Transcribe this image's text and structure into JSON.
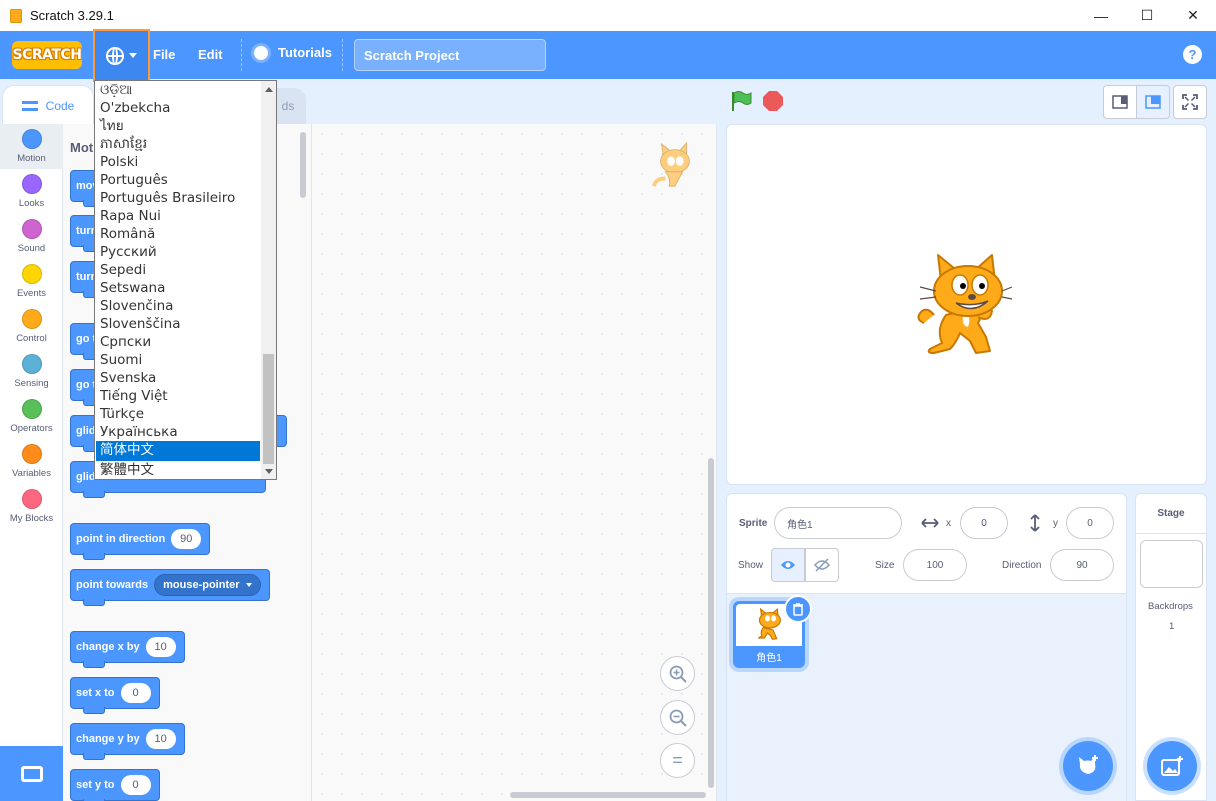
{
  "window": {
    "title": "Scratch 3.29.1",
    "minimize": "—",
    "maximize": "☐",
    "close": "✕"
  },
  "menubar": {
    "logo": "SCRATCH",
    "file": "File",
    "edit": "Edit",
    "tutorials": "Tutorials",
    "project_title": "Scratch Project",
    "help": "?"
  },
  "tabs": {
    "code": "Code",
    "sounds_partial": "ds"
  },
  "categories": [
    {
      "label": "Motion",
      "color": "#4c97ff"
    },
    {
      "label": "Looks",
      "color": "#9966ff"
    },
    {
      "label": "Sound",
      "color": "#cf63cf"
    },
    {
      "label": "Events",
      "color": "#ffd500"
    },
    {
      "label": "Control",
      "color": "#ffab19"
    },
    {
      "label": "Sensing",
      "color": "#5cb1d6"
    },
    {
      "label": "Operators",
      "color": "#59c059"
    },
    {
      "label": "Variables",
      "color": "#ff8c1a"
    },
    {
      "label": "My Blocks",
      "color": "#ff6680"
    }
  ],
  "palette": {
    "title_partial": "Moti",
    "partial_blocks": [
      "mov",
      "turn",
      "turn",
      "go t",
      "go t",
      "glide",
      "glide"
    ],
    "point_in_direction": {
      "label": "point in direction",
      "value": "90"
    },
    "point_towards": {
      "label": "point towards",
      "value": "mouse-pointer"
    },
    "change_x": {
      "label": "change x by",
      "value": "10"
    },
    "set_x": {
      "label": "set x to",
      "value": "0"
    },
    "change_y": {
      "label": "change y by",
      "value": "10"
    },
    "set_y": {
      "label": "set y to",
      "value": "0"
    }
  },
  "zoom": {
    "zoom_in": "+",
    "zoom_out": "−",
    "reset": "="
  },
  "sprite_info": {
    "sprite_label": "Sprite",
    "sprite_name": "角色1",
    "x_label": "x",
    "x_value": "0",
    "y_label": "y",
    "y_value": "0",
    "show_label": "Show",
    "size_label": "Size",
    "size_value": "100",
    "direction_label": "Direction",
    "direction_value": "90"
  },
  "sprite_list": [
    {
      "name": "角色1"
    }
  ],
  "stage_pane": {
    "title": "Stage",
    "backdrops_label": "Backdrops",
    "backdrops_count": "1"
  },
  "language_menu": {
    "options": [
      "ଓଡ଼ିଆ",
      "O'zbekcha",
      "ไทย",
      "ភាសាខ្មែរ",
      "Polski",
      "Português",
      "Português Brasileiro",
      "Rapa Nui",
      "Română",
      "Русский",
      "Sepedi",
      "Setswana",
      "Slovenčina",
      "Slovenščina",
      "Српски",
      "Suomi",
      "Svenska",
      "Tiếng Việt",
      "Türkçe",
      "Українська",
      "简体中文",
      "繁體中文"
    ],
    "selected": "简体中文"
  },
  "colors": {
    "menu_blue": "#4c97ff",
    "motion_block": "#4c97ff",
    "highlight_orange": "#ff9a3a",
    "selection": "#0078d7"
  }
}
